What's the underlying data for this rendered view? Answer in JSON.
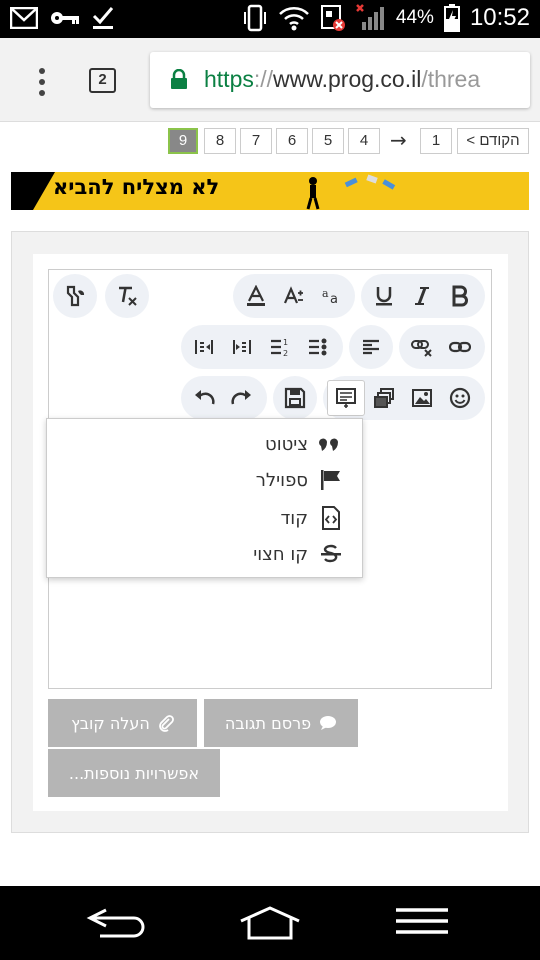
{
  "status": {
    "battery_pct": "44%",
    "time": "10:52"
  },
  "browser": {
    "tab_count": "2",
    "url_scheme": "https",
    "url_sep": "://",
    "url_host": "www.prog.co.il",
    "url_path": "/threa"
  },
  "pagination": {
    "prev": "< הקודם",
    "pages": [
      "9",
      "8",
      "7",
      "6",
      "5",
      "4"
    ],
    "arrow": "→",
    "first": "1",
    "active": "9"
  },
  "banner": {
    "text": "לא מצליח להביא"
  },
  "dropdown": {
    "items": [
      {
        "label": "ציטוט",
        "icon": "quote-icon"
      },
      {
        "label": "ספוילר",
        "icon": "flag-icon"
      },
      {
        "label": "קוד",
        "icon": "code-file-icon"
      },
      {
        "label": "קו חצוי",
        "icon": "strikethrough-icon"
      }
    ]
  },
  "buttons": {
    "upload": "העלה קובץ",
    "publish": "פרסם תגובה",
    "more": "אפשרויות נוספות..."
  },
  "colors": {
    "https_green": "#0b8043",
    "banner_yellow": "#f5c518",
    "button_gray": "#b5b5b5",
    "toolbar_group": "#eef1f6"
  }
}
